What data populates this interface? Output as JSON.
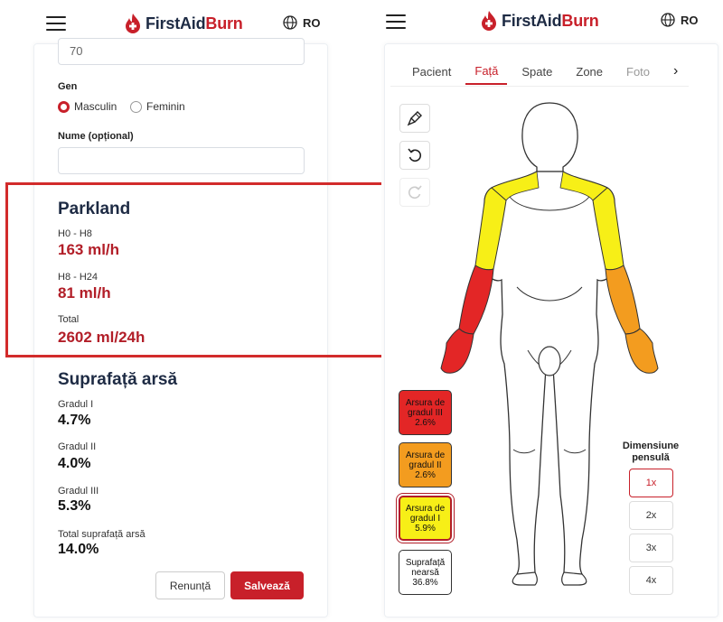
{
  "app": {
    "logo_first": "FirstAid",
    "logo_burn": "Burn",
    "lang": "RO"
  },
  "colors": {
    "brand_red": "#c8202a",
    "navy": "#1e2b44",
    "third_degree": "#e32626",
    "second_degree": "#f39c1f",
    "first_degree": "#f7ef17"
  },
  "left": {
    "age_value": "70",
    "gender_label": "Gen",
    "gender_options": [
      "Masculin",
      "Feminin"
    ],
    "gender_selected": "Masculin",
    "name_label": "Nume (opțional)",
    "name_value": "",
    "parkland": {
      "title": "Parkland",
      "h0_h8_label": "H0 - H8",
      "h0_h8_value": "163 ml/h",
      "h8_h24_label": "H8 - H24",
      "h8_h24_value": "81 ml/h",
      "total_label": "Total",
      "total_value": "2602 ml/24h"
    },
    "burned": {
      "title": "Suprafață arsă",
      "g1_label": "Gradul I",
      "g1_value": "4.7%",
      "g2_label": "Gradul II",
      "g2_value": "4.0%",
      "g3_label": "Gradul III",
      "g3_value": "5.3%",
      "total_label": "Total suprafață arsă",
      "total_value": "14.0%"
    },
    "cancel_label": "Renunță",
    "save_label": "Salvează"
  },
  "right": {
    "tabs": [
      "Pacient",
      "Față",
      "Spate",
      "Zone",
      "Foto"
    ],
    "active_tab": "Față",
    "tools": [
      "brush-icon",
      "undo-icon",
      "redo-icon"
    ],
    "legend": {
      "g3_label": "Arsura de gradul III",
      "g3_value": "2.6%",
      "g2_label": "Arsura de gradul II",
      "g2_value": "2.6%",
      "g1_label": "Arsura de gradul I",
      "g1_value": "5.9%",
      "unburned_label": "Suprafață nearsă",
      "unburned_value": "36.8%"
    },
    "brush_size_title": "Dimensiune pensulă",
    "brush_sizes": [
      "1x",
      "2x",
      "3x",
      "4x"
    ],
    "brush_selected": "1x"
  }
}
